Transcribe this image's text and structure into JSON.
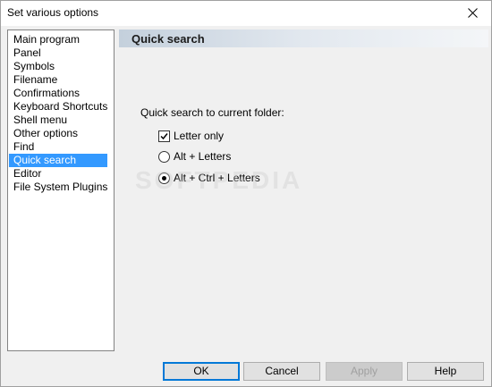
{
  "window": {
    "title": "Set various options"
  },
  "tree": {
    "items": [
      {
        "label": "Main program"
      },
      {
        "label": "Panel"
      },
      {
        "label": "Symbols"
      },
      {
        "label": "Filename"
      },
      {
        "label": "Confirmations"
      },
      {
        "label": "Keyboard Shortcuts"
      },
      {
        "label": "Shell menu"
      },
      {
        "label": "Other options"
      },
      {
        "label": "Find"
      },
      {
        "label": "Quick search"
      },
      {
        "label": "Editor"
      },
      {
        "label": "File System Plugins"
      }
    ],
    "selected": "Quick search"
  },
  "panel": {
    "title": "Quick search",
    "group_label": "Quick search to current folder:",
    "options": {
      "letter_only": {
        "label": "Letter only",
        "checked": true
      },
      "alt_letters": {
        "label": "Alt + Letters",
        "checked": false
      },
      "alt_ctrl_letters": {
        "label": "Alt + Ctrl + Letters",
        "checked": true
      }
    }
  },
  "watermark": "SOFTPEDIA",
  "buttons": {
    "ok": "OK",
    "cancel": "Cancel",
    "apply": "Apply",
    "help": "Help"
  }
}
